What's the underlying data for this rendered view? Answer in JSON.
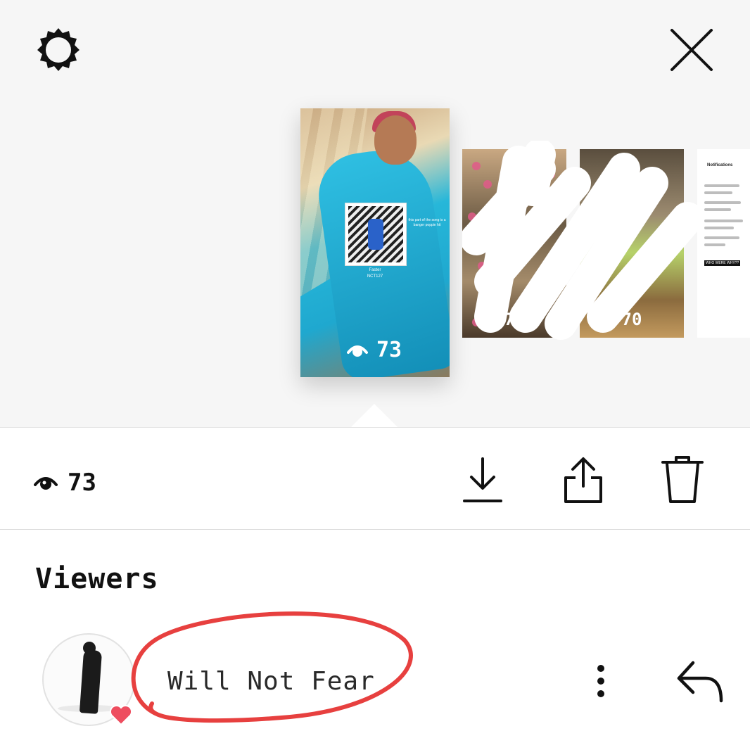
{
  "header": {
    "settings_icon": "gear-icon",
    "close_icon": "close-icon"
  },
  "stories": {
    "main": {
      "song_title": "Faster",
      "song_artist": "NCT127",
      "caption": "this part of the song is a banger poppin hit",
      "views": "73"
    },
    "thumbnails": [
      {
        "views": "73"
      },
      {
        "views": "70"
      },
      {
        "title": "Notifications",
        "tag": "WHO WERE WHY??"
      }
    ]
  },
  "stats": {
    "views": "73",
    "eye_icon": "eye-icon",
    "download_icon": "download-icon",
    "share_icon": "share-icon",
    "delete_icon": "trash-icon"
  },
  "viewers": {
    "title": "Viewers",
    "list": [
      {
        "name": "Will Not Fear",
        "liked": true,
        "heart_color": "#ee4d5f",
        "more_icon": "more-vertical-icon",
        "reply_icon": "reply-icon"
      }
    ]
  },
  "annotation_color": "#e7403f"
}
